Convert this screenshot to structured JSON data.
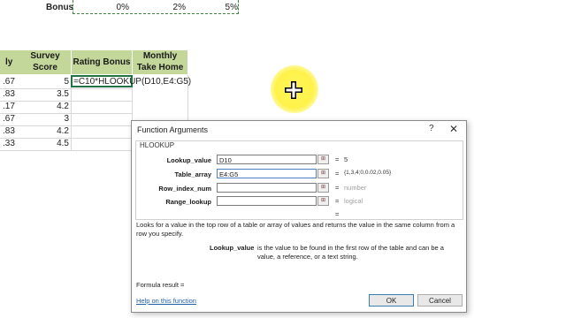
{
  "bonus_row": {
    "label": "Bonus",
    "values": [
      "0%",
      "2%",
      "5%"
    ]
  },
  "headers": {
    "col_a_partial": "ly",
    "survey_score": [
      "Survey",
      "Score"
    ],
    "rating_bonus": "Rating Bonus",
    "monthly_take_home": [
      "Monthly",
      "Take Home"
    ]
  },
  "rows": [
    {
      "a": ".67",
      "score": "5"
    },
    {
      "a": ".83",
      "score": "3.5"
    },
    {
      "a": ".17",
      "score": "4.2"
    },
    {
      "a": ".67",
      "score": "3"
    },
    {
      "a": ".83",
      "score": "4.2"
    },
    {
      "a": ".33",
      "score": "4.5"
    }
  ],
  "formula_cell": "=C10*HLOOKUP(D10,E4:G5)",
  "dialog": {
    "title": "Function Arguments",
    "help_symbol": "?",
    "close_symbol": "✕",
    "function_name": "HLOOKUP",
    "fields": [
      {
        "label": "Lookup_value",
        "value": "D10",
        "result": "5",
        "grey": false
      },
      {
        "label": "Table_array",
        "value": "E4:G5",
        "result": "{1,3,4;0,0.02,0.05}",
        "grey": false
      },
      {
        "label": "Row_index_num",
        "value": "",
        "result": "number",
        "grey": true
      },
      {
        "label": "Range_lookup",
        "value": "",
        "result": "logical",
        "grey": true
      }
    ],
    "equals_sign": "=",
    "description": "Looks for a value in the top row of a table or array of values and returns the value in the same column from a row you specify.",
    "arg_name": "Lookup_value",
    "arg_desc_line1": "is the value to be found in the first row of the table and can be a",
    "arg_desc_line2": "value, a reference, or a text string.",
    "formula_result": "Formula result =",
    "help_link": "Help on this function",
    "ok_label": "OK",
    "cancel_label": "Cancel"
  },
  "colors": {
    "header_fill": "#c4d79b",
    "cursor_highlight": "#fff24a",
    "link": "#1f5fa8"
  }
}
